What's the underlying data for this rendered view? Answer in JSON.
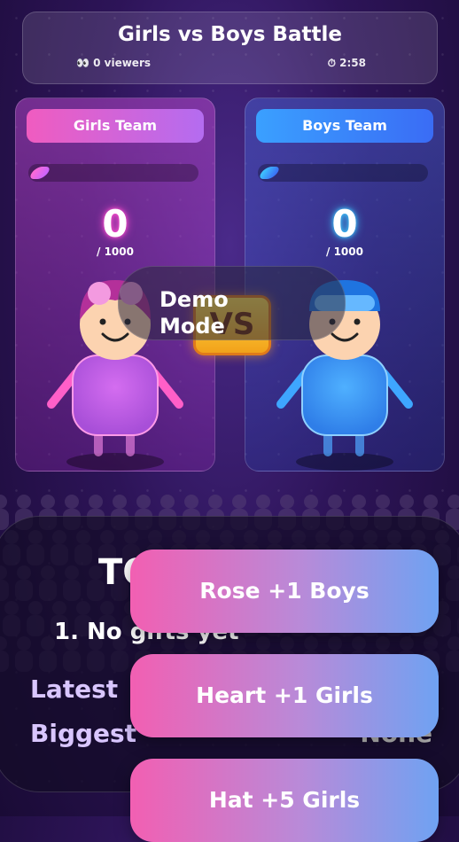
{
  "header": {
    "title": "Girls vs Boys Battle",
    "viewers": "👀 0 viewers",
    "timer": "⏱ 2:58"
  },
  "girls": {
    "label": "Girls Team",
    "score": "0",
    "target": "/ 1000",
    "progress_fraction": 0
  },
  "boys": {
    "label": "Boys Team",
    "score": "0",
    "target": "/ 1000",
    "progress_fraction": 0
  },
  "vs": "VS",
  "demo": {
    "label": "Demo Mode"
  },
  "leaderboard": {
    "title_partial": "TO",
    "first_row": "1. No gifts yet",
    "latest_label": "Latest",
    "biggest_label": "Biggest",
    "biggest_value": "None"
  },
  "gift_buttons": [
    {
      "label": "Rose +1 Boys"
    },
    {
      "label": "Heart +1 Girls"
    },
    {
      "label": "Hat +5 Girls"
    }
  ],
  "colors": {
    "girls_accent": "#f05cc0",
    "boys_accent": "#3aa0ff",
    "vs_badge": "#ffe04a"
  }
}
